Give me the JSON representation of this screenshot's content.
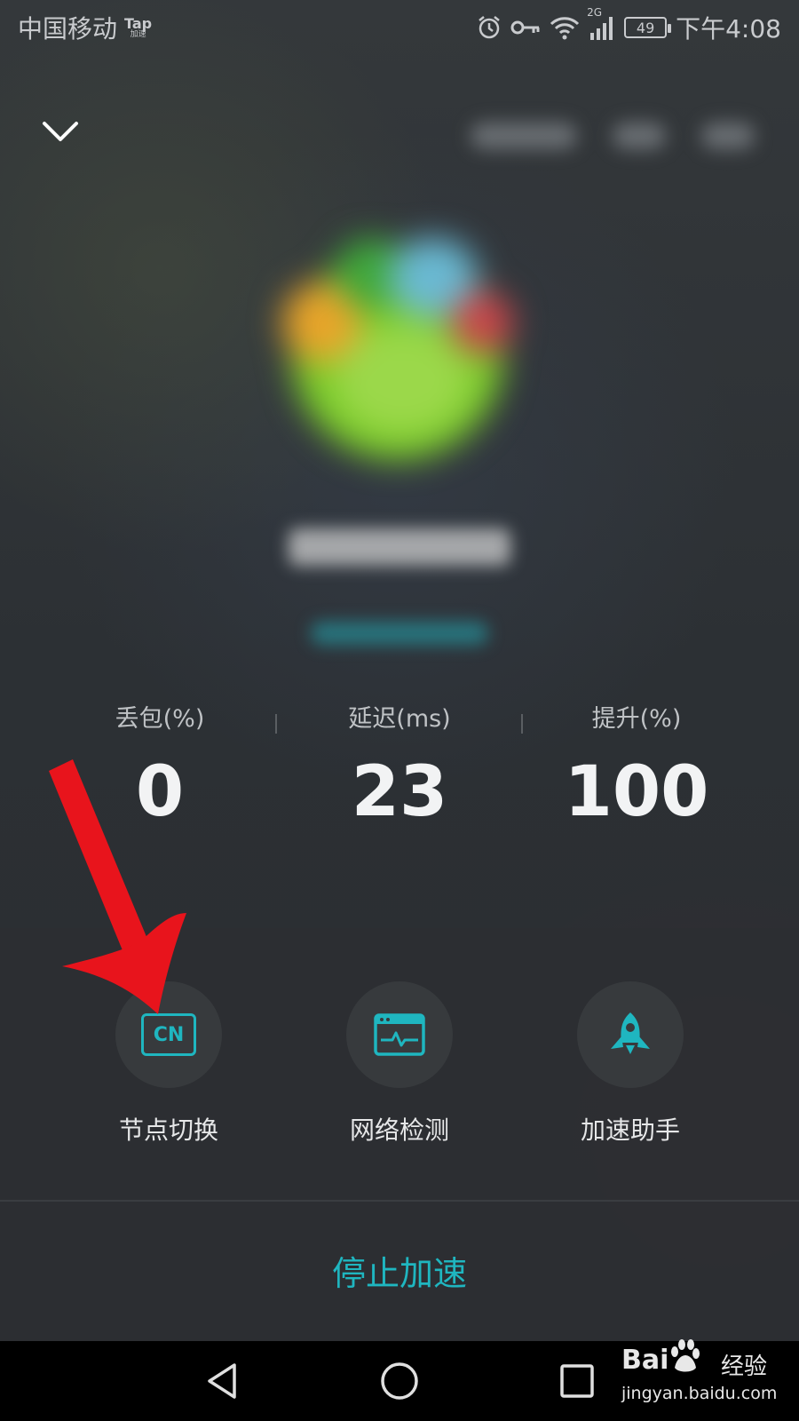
{
  "status_bar": {
    "carrier": "中国移动",
    "tap_badge_top": "Tap",
    "tap_badge_bottom": "加速",
    "network_type": "2G",
    "battery": "49",
    "time": "下午4:08",
    "icons": [
      "alarm-icon",
      "vpn-key-icon",
      "wifi-icon",
      "signal-icon",
      "battery-icon"
    ]
  },
  "header": {
    "collapse_icon": "chevron-down-icon"
  },
  "stats": [
    {
      "label": "丢包(%)",
      "value": "0"
    },
    {
      "label": "延迟(ms)",
      "value": "23"
    },
    {
      "label": "提升(%)",
      "value": "100"
    }
  ],
  "actions": [
    {
      "label": "节点切换",
      "icon": "node-switch-icon",
      "icon_text": "CN"
    },
    {
      "label": "网络检测",
      "icon": "network-check-icon"
    },
    {
      "label": "加速助手",
      "icon": "rocket-icon"
    }
  ],
  "stop_button": "停止加速",
  "nav": [
    "back-icon",
    "home-icon",
    "recents-icon"
  ],
  "watermark": {
    "main": "Bai",
    "suffix": "经验",
    "url": "jingyan.baidu.com"
  },
  "colors": {
    "accent": "#1fb6c0",
    "annotation_arrow": "#e8141c"
  }
}
